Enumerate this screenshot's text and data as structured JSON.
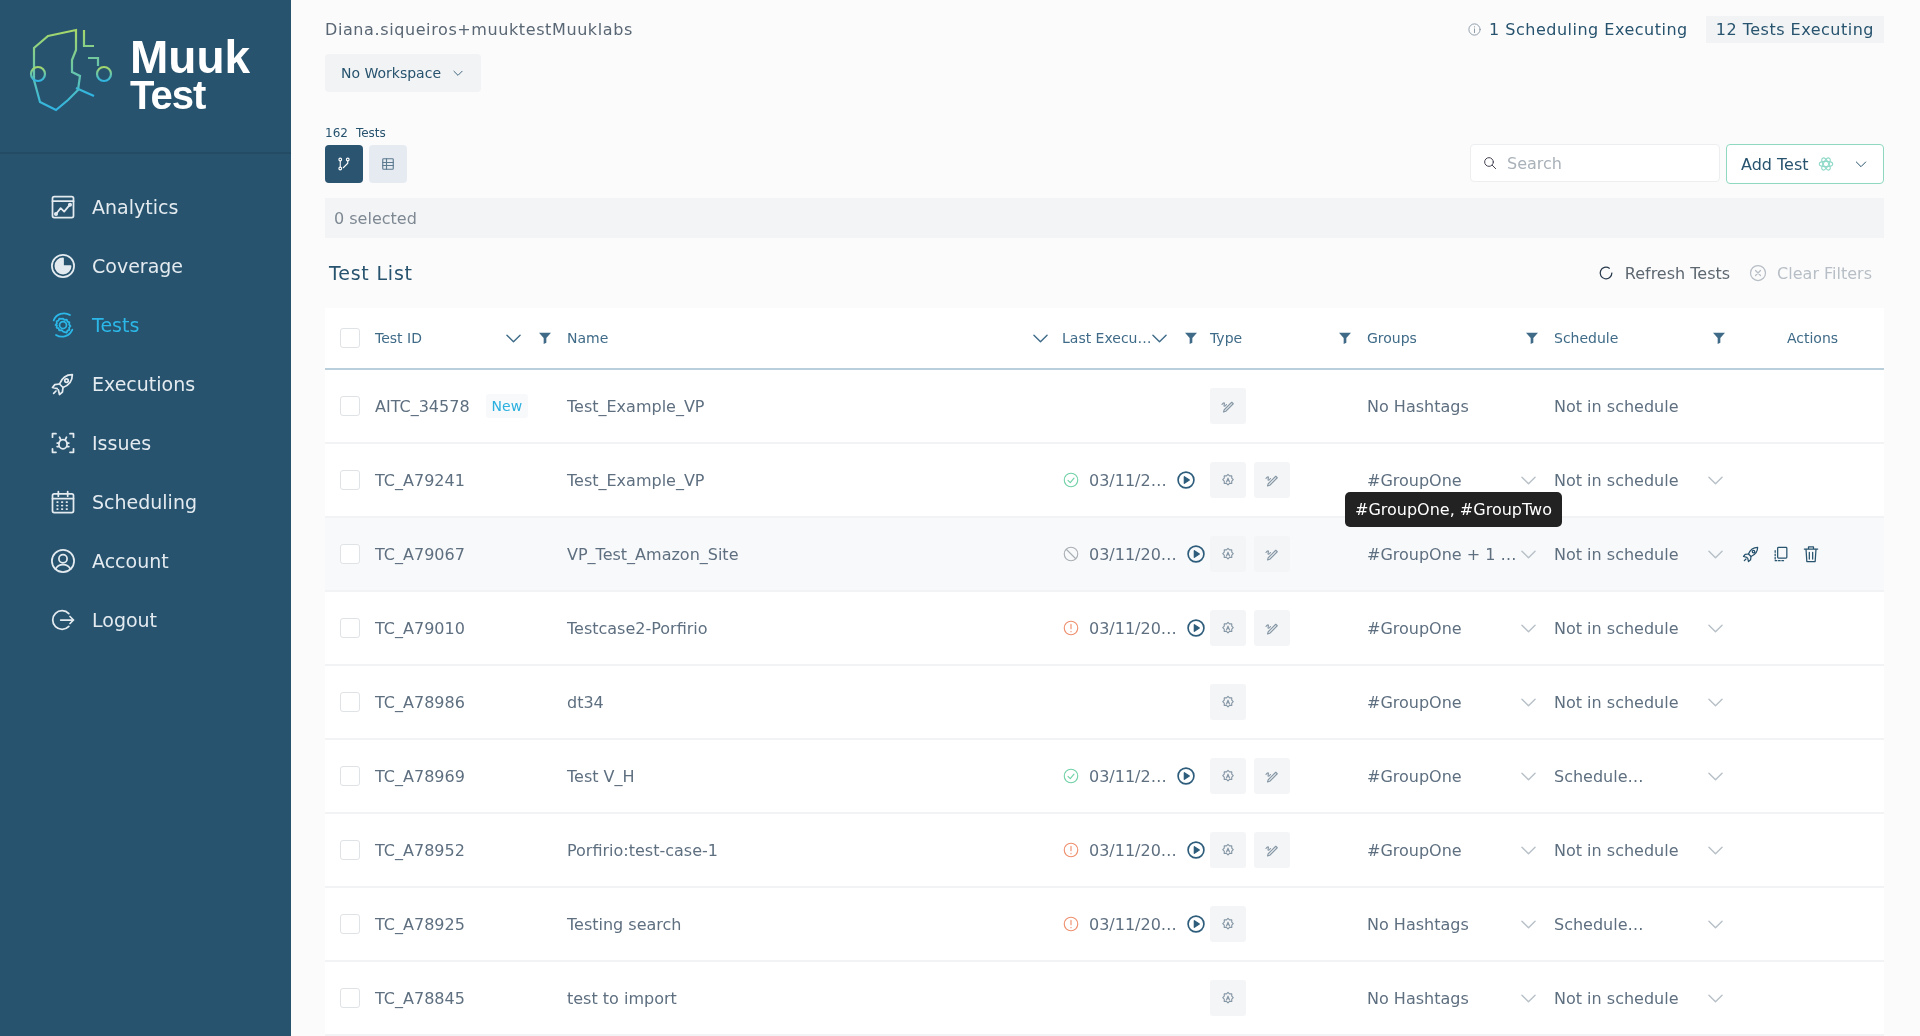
{
  "logo": {
    "line_1": "Muuk",
    "line_2": "Test"
  },
  "sidebar": {
    "items": [
      {
        "label": "Analytics",
        "selected": false
      },
      {
        "label": "Coverage",
        "selected": false
      },
      {
        "label": "Tests",
        "selected": true
      },
      {
        "label": "Executions",
        "selected": false
      },
      {
        "label": "Issues",
        "selected": false
      },
      {
        "label": "Scheduling",
        "selected": false
      },
      {
        "label": "Account",
        "selected": false
      },
      {
        "label": "Logout",
        "selected": false
      }
    ]
  },
  "header": {
    "user": "Diana.siqueiros+muuktestMuuklabs",
    "workspace": "No Workspace",
    "scheduling_status": "1 Scheduling Executing",
    "tests_status": "12 Tests Executing"
  },
  "toolbar": {
    "count": "162",
    "count_label": "Tests",
    "views": [
      {
        "selected": true
      },
      {
        "selected": false
      }
    ],
    "search": {
      "placeholder": "Search"
    },
    "add_button": "Add Test"
  },
  "selection": "0 selected",
  "list": {
    "title": "Test List",
    "refresh": "Refresh Tests",
    "clear_filters": {
      "label": "Clear Filters",
      "disabled": true
    }
  },
  "table": {
    "all_checked": false,
    "columns": [
      {
        "label": "Test ID",
        "sortable": true,
        "filterable": true
      },
      {
        "label": "Name",
        "sortable": true,
        "filterable": false
      },
      {
        "label": "Last Execu…",
        "sortable": true,
        "filterable": true
      },
      {
        "label": "Type",
        "sortable": false,
        "filterable": true
      },
      {
        "label": "Groups",
        "sortable": false,
        "filterable": true
      },
      {
        "label": "Schedule",
        "sortable": false,
        "filterable": true
      },
      {
        "label": "Actions",
        "sortable": false,
        "filterable": false
      }
    ],
    "rows": [
      {
        "checked": false,
        "id": "AITC_34578",
        "badge": "New",
        "name": "Test_Example_VP",
        "types": [
          {
            "kind": "manual"
          }
        ],
        "groups": "No Hashtags",
        "schedule": "Not in schedule",
        "dropdowns": false,
        "hovered": false
      },
      {
        "checked": false,
        "id": "TC_A79241",
        "name": "Test_Example_VP",
        "last": {
          "kind": "passed",
          "date": "03/11/2…"
        },
        "types": [
          {
            "kind": "ai"
          },
          {
            "kind": "manual"
          }
        ],
        "groups": "#GroupOne",
        "schedule": "Not in schedule",
        "dropdowns": true,
        "hovered": false
      },
      {
        "checked": false,
        "id": "TC_A79067",
        "name": "VP_Test_Amazon_Site",
        "last": {
          "kind": "stopped",
          "date": "03/11/20…"
        },
        "types": [
          {
            "kind": "ai"
          },
          {
            "kind": "manual"
          }
        ],
        "groups": "#GroupOne + 1 …",
        "tooltip": "#GroupOne, #GroupTwo",
        "schedule": "Not in schedule",
        "dropdowns": true,
        "hovered": true
      },
      {
        "checked": false,
        "id": "TC_A79010",
        "name": "Testcase2-Porfirio",
        "last": {
          "kind": "error",
          "date": "03/11/20…"
        },
        "types": [
          {
            "kind": "ai"
          },
          {
            "kind": "manual"
          }
        ],
        "groups": "#GroupOne",
        "schedule": "Not in schedule",
        "dropdowns": true,
        "hovered": false
      },
      {
        "checked": false,
        "id": "TC_A78986",
        "name": "dt34",
        "types": [
          {
            "kind": "ai"
          }
        ],
        "groups": "#GroupOne",
        "schedule": "Not in schedule",
        "dropdowns": true,
        "hovered": false
      },
      {
        "checked": false,
        "id": "TC_A78969",
        "name": "Test V_H",
        "last": {
          "kind": "passed",
          "date": "03/11/2…"
        },
        "types": [
          {
            "kind": "ai"
          },
          {
            "kind": "manual"
          }
        ],
        "groups": "#GroupOne",
        "schedule": "Schedule…",
        "dropdowns": true,
        "hovered": false
      },
      {
        "checked": false,
        "id": "TC_A78952",
        "name": "Porfirio:test-case-1",
        "last": {
          "kind": "error",
          "date": "03/11/20…"
        },
        "types": [
          {
            "kind": "ai"
          },
          {
            "kind": "manual"
          }
        ],
        "groups": "#GroupOne",
        "schedule": "Not in schedule",
        "dropdowns": true,
        "hovered": false
      },
      {
        "checked": false,
        "id": "TC_A78925",
        "name": "Testing search",
        "last": {
          "kind": "error",
          "date": "03/11/20…"
        },
        "types": [
          {
            "kind": "ai"
          }
        ],
        "groups": "No Hashtags",
        "schedule": "Schedule…",
        "dropdowns": true,
        "hovered": false
      },
      {
        "checked": false,
        "id": "TC_A78845",
        "name": "test to import",
        "types": [
          {
            "kind": "ai"
          }
        ],
        "groups": "No Hashtags",
        "schedule": "Not in schedule",
        "dropdowns": true,
        "hovered": false
      }
    ]
  }
}
